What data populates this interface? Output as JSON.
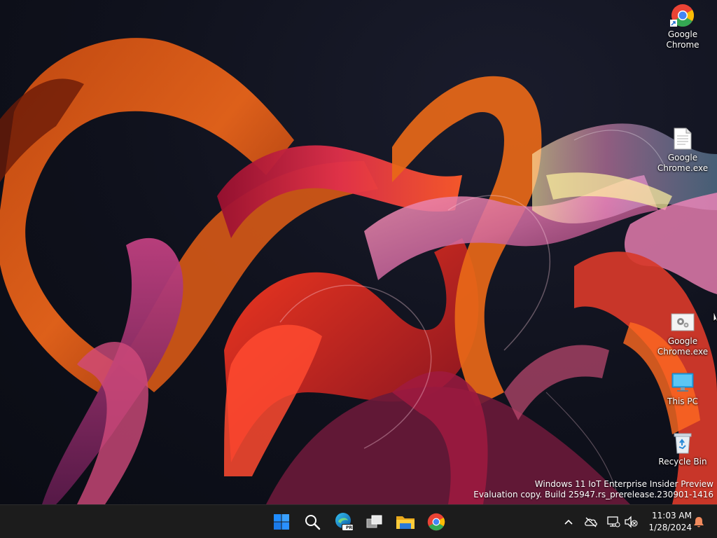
{
  "desktop": {
    "icons": [
      {
        "name": "google-chrome-shortcut",
        "label": "Google\nChrome",
        "icon": "chrome-icon"
      },
      {
        "name": "google-chrome-exe-file",
        "label": "Google\nChrome.exe",
        "icon": "document-icon"
      },
      {
        "name": "google-chrome-exe-installer",
        "label": "Google\nChrome.exe",
        "icon": "installer-gear-icon"
      },
      {
        "name": "this-pc",
        "label": "This PC",
        "icon": "monitor-icon"
      },
      {
        "name": "recycle-bin",
        "label": "Recycle Bin",
        "icon": "recycle-bin-icon"
      }
    ]
  },
  "watermark": {
    "line1": "Windows 11 IoT Enterprise Insider Preview",
    "line2": "Evaluation copy. Build 25947.rs_prerelease.230901-1416"
  },
  "taskbar": {
    "pinned": [
      {
        "name": "start-button",
        "icon": "windows-logo-icon"
      },
      {
        "name": "search-button",
        "icon": "search-icon"
      },
      {
        "name": "edge-preview-button",
        "icon": "edge-icon",
        "badge": "PRE"
      },
      {
        "name": "task-view-button",
        "icon": "task-view-icon"
      },
      {
        "name": "file-explorer-button",
        "icon": "folder-icon"
      },
      {
        "name": "chrome-taskbar-button",
        "icon": "chrome-icon"
      }
    ],
    "tray": {
      "icons": [
        "chevron-up-icon",
        "onedrive-offline-icon",
        "network-icon",
        "volume-muted-icon"
      ],
      "time": "11:03 AM",
      "date": "1/28/2024",
      "notification_icon": "bell-icon",
      "notification_color": "#f08a5d"
    }
  },
  "colors": {
    "taskbar_bg": "#1c1c1c",
    "windows_blue": "#1f8cff",
    "chrome_red": "#ea4335",
    "chrome_yellow": "#fbbc05",
    "chrome_green": "#34a853",
    "chrome_blue": "#4285f4"
  }
}
